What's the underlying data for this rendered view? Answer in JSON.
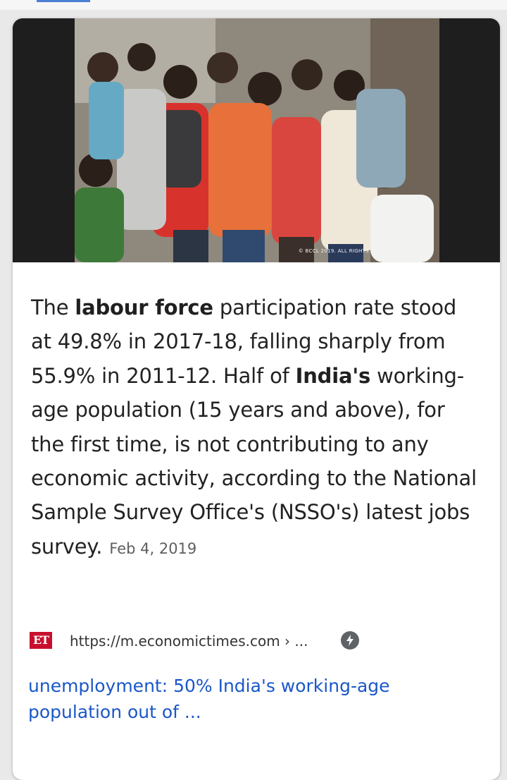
{
  "photo": {
    "alt": "",
    "credit": "© BCCL 2019. ALL RIGHTS RESERVED"
  },
  "snippet": {
    "part1": "The ",
    "bold1": "labour force",
    "part2": " participation rate stood at 49.8% in 2017-18, falling sharply from 55.9% in 2011-12. Half of ",
    "bold2": "India's",
    "part3": " working-age population (15 years and above), for the first time, is not contributing to any economic activity, according to the National Sample Survey Office's (NSSO's) latest jobs survey.",
    "date": "Feb 4, 2019"
  },
  "source": {
    "logo_text": "ET",
    "url": "https://m.economictimes.com › ...",
    "amp_icon": "amp-lightning-icon"
  },
  "result": {
    "title": "unemployment: 50% India's working-age population out of ..."
  },
  "colors": {
    "link": "#1a57c8",
    "logo": "#c8102e",
    "text": "#222222",
    "date": "#5f5f5f"
  }
}
